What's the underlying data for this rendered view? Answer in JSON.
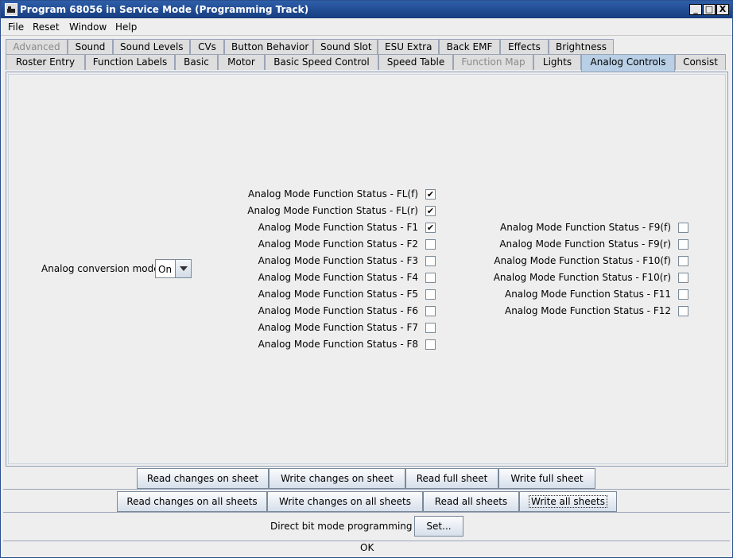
{
  "window": {
    "title": "Program 68056 in Service Mode (Programming Track)",
    "controls": [
      "_",
      "□",
      "X"
    ]
  },
  "menu": [
    "File",
    "Reset",
    "Window",
    "Help"
  ],
  "tabs_row1": [
    {
      "label": "Advanced",
      "state": "disabled"
    },
    {
      "label": "Sound",
      "state": "normal"
    },
    {
      "label": "Sound Levels",
      "state": "normal"
    },
    {
      "label": "CVs",
      "state": "normal"
    },
    {
      "label": "Button Behavior",
      "state": "normal"
    },
    {
      "label": "Sound Slot",
      "state": "normal"
    },
    {
      "label": "ESU Extra",
      "state": "normal"
    },
    {
      "label": "Back EMF",
      "state": "normal"
    },
    {
      "label": "Effects",
      "state": "normal"
    },
    {
      "label": "Brightness",
      "state": "normal"
    }
  ],
  "tabs_row2": [
    {
      "label": "Roster Entry",
      "state": "normal"
    },
    {
      "label": "Function Labels",
      "state": "normal"
    },
    {
      "label": "Basic",
      "state": "normal"
    },
    {
      "label": "Motor",
      "state": "normal"
    },
    {
      "label": "Basic Speed Control",
      "state": "normal"
    },
    {
      "label": "Speed Table",
      "state": "normal"
    },
    {
      "label": "Function Map",
      "state": "disabled"
    },
    {
      "label": "Lights",
      "state": "normal"
    },
    {
      "label": "Analog Controls",
      "state": "selected"
    },
    {
      "label": "Consist",
      "state": "normal"
    }
  ],
  "analog": {
    "mode_label": "Analog conversion mode",
    "mode_value": "On",
    "left_items": [
      {
        "label": "Analog Mode Function Status - FL(f)",
        "checked": true
      },
      {
        "label": "Analog Mode Function Status - FL(r)",
        "checked": true
      },
      {
        "label": "Analog Mode Function Status - F1",
        "checked": true
      },
      {
        "label": "Analog Mode Function Status - F2",
        "checked": false
      },
      {
        "label": "Analog Mode Function Status - F3",
        "checked": false
      },
      {
        "label": "Analog Mode Function Status - F4",
        "checked": false
      },
      {
        "label": "Analog Mode Function Status - F5",
        "checked": false
      },
      {
        "label": "Analog Mode Function Status - F6",
        "checked": false
      },
      {
        "label": "Analog Mode Function Status - F7",
        "checked": false
      },
      {
        "label": "Analog Mode Function Status - F8",
        "checked": false
      }
    ],
    "right_items": [
      {
        "label": "Analog Mode Function Status - F9(f)",
        "checked": false
      },
      {
        "label": "Analog Mode Function Status - F9(r)",
        "checked": false
      },
      {
        "label": "Analog Mode Function Status - F10(f)",
        "checked": false
      },
      {
        "label": "Analog Mode Function Status - F10(r)",
        "checked": false
      },
      {
        "label": "Analog Mode Function Status - F11",
        "checked": false
      },
      {
        "label": "Analog Mode Function Status - F12",
        "checked": false
      }
    ]
  },
  "sheet_buttons": {
    "read_changes": "Read changes on sheet",
    "write_changes": "Write changes on sheet",
    "read_full": "Read full sheet",
    "write_full": "Write full sheet"
  },
  "all_buttons": {
    "read_changes_all": "Read changes on all sheets",
    "write_changes_all": "Write changes on all sheets",
    "read_all": "Read all sheets",
    "write_all": "Write all sheets"
  },
  "direct": {
    "label": "Direct bit mode programming",
    "button": "Set..."
  },
  "status": "OK",
  "colors": {
    "titlebar": "#1f4a92",
    "selected_tab": "#b8cfe5",
    "background": "#eeeeee"
  }
}
